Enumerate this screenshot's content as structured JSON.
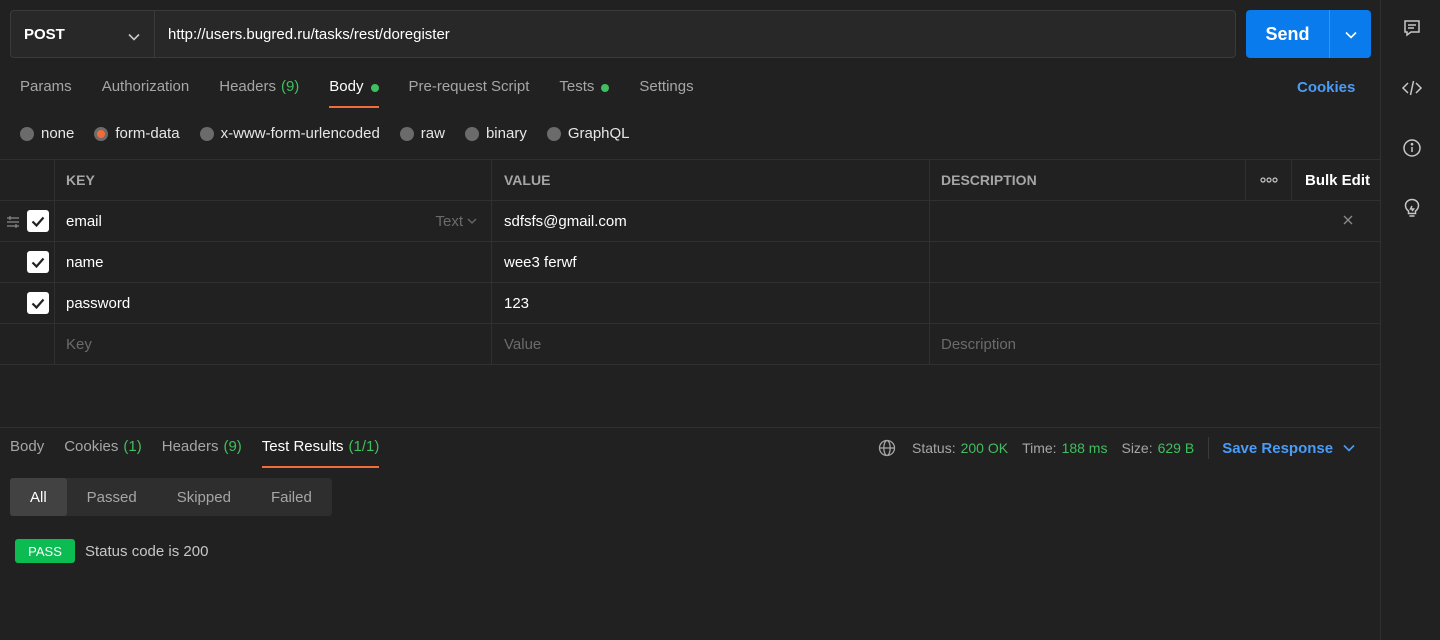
{
  "request": {
    "method": "POST",
    "url": "http://users.bugred.ru/tasks/rest/doregister",
    "send_label": "Send"
  },
  "request_tabs": {
    "params": "Params",
    "authorization": "Authorization",
    "headers": "Headers",
    "headers_count": "(9)",
    "body": "Body",
    "prerequest": "Pre-request Script",
    "tests": "Tests",
    "settings": "Settings",
    "cookies": "Cookies"
  },
  "body_modes": {
    "none": "none",
    "form_data": "form-data",
    "urlencoded": "x-www-form-urlencoded",
    "raw": "raw",
    "binary": "binary",
    "graphql": "GraphQL",
    "selected": "form-data"
  },
  "table": {
    "headers": {
      "key": "KEY",
      "value": "VALUE",
      "description": "DESCRIPTION",
      "more": "ooo",
      "bulk_edit": "Bulk Edit"
    },
    "rows": [
      {
        "key": "email",
        "value": "sdfsfs@gmail.com",
        "type": "Text",
        "checked": true
      },
      {
        "key": "name",
        "value": "wee3 ferwf",
        "checked": true
      },
      {
        "key": "password",
        "value": "123",
        "checked": true
      }
    ],
    "placeholders": {
      "key": "Key",
      "value": "Value",
      "description": "Description"
    }
  },
  "response_tabs": {
    "body": "Body",
    "cookies": "Cookies",
    "cookies_count": "(1)",
    "headers": "Headers",
    "headers_count": "(9)",
    "test_results": "Test Results",
    "test_results_count": "(1/1)"
  },
  "status": {
    "status_label": "Status:",
    "status_value": "200 OK",
    "time_label": "Time:",
    "time_value": "188 ms",
    "size_label": "Size:",
    "size_value": "629 B",
    "save_response": "Save Response"
  },
  "filters": [
    "All",
    "Passed",
    "Skipped",
    "Failed"
  ],
  "results": [
    {
      "badge": "PASS",
      "text": "Status code is 200"
    }
  ],
  "colors": {
    "accent": "#f26b3a",
    "send": "#097bed",
    "success": "#3fbf5e",
    "link": "#4a9cf6"
  }
}
